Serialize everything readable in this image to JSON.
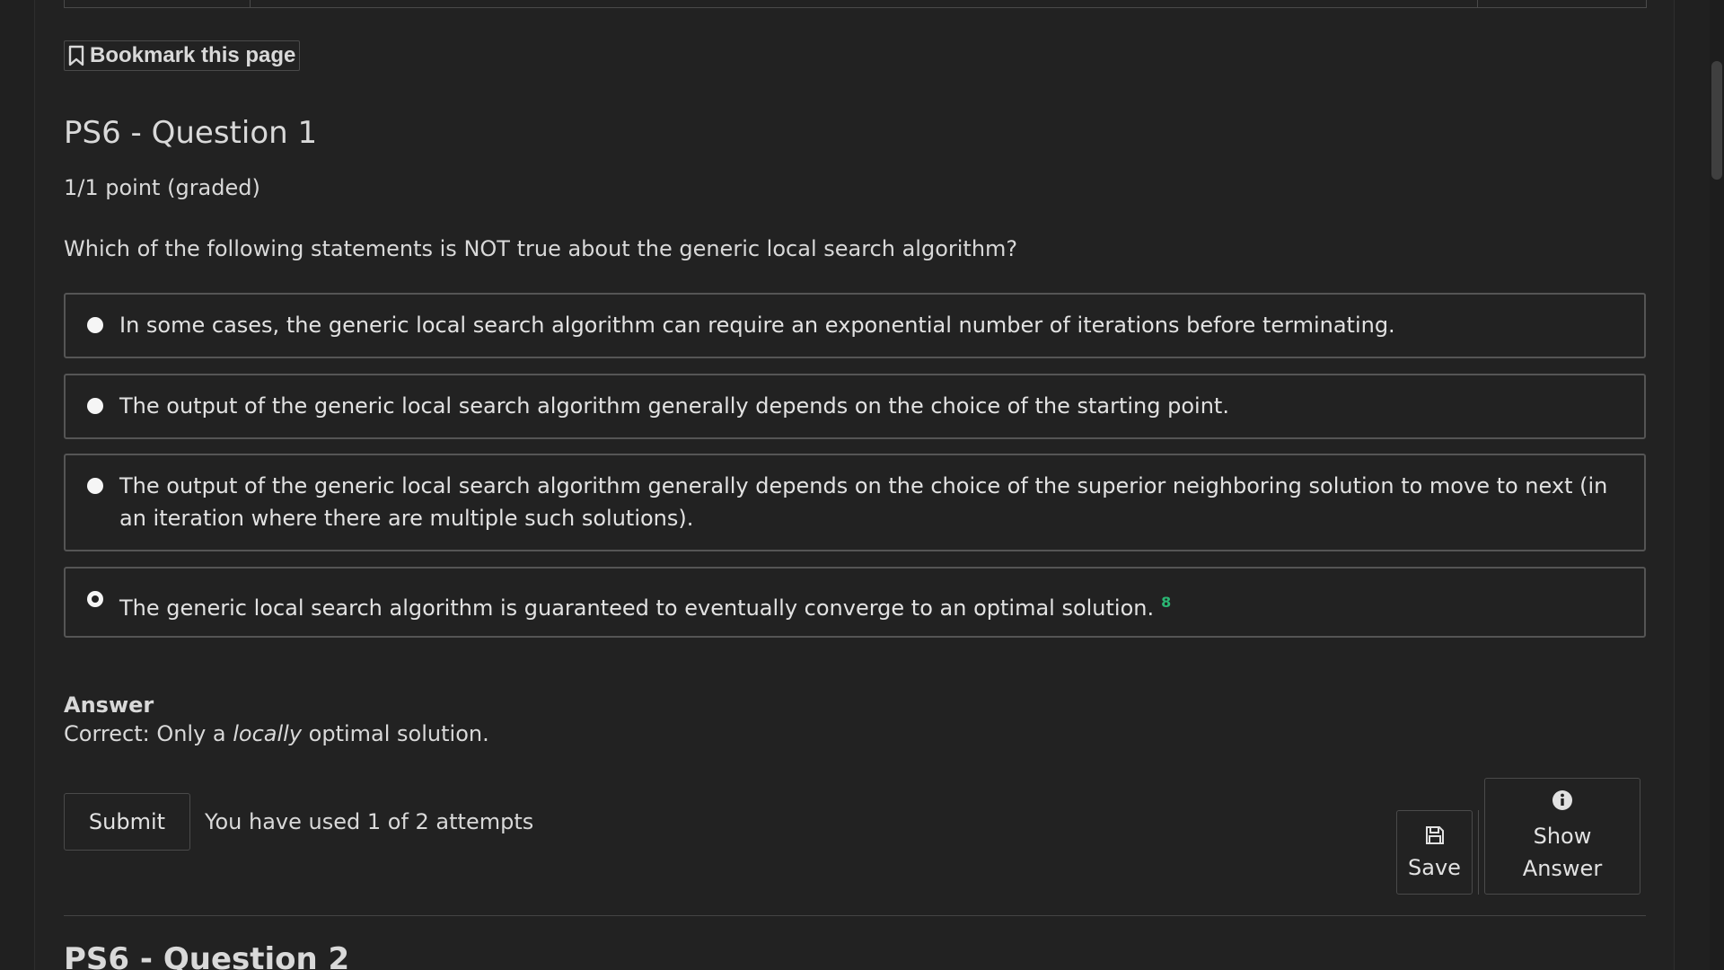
{
  "bookmark": {
    "label": "Bookmark this page",
    "icon": "bookmark-icon"
  },
  "question": {
    "title": "PS6 - Question 1",
    "points": "1/1 point (graded)",
    "prompt": "Which of the following statements is NOT true about the generic local search algorithm?",
    "choices": [
      {
        "text": "In some cases, the generic local search algorithm can require an exponential number of iterations before terminating.",
        "selected": false
      },
      {
        "text": "The output of the generic local search algorithm generally depends on the choice of the starting point.",
        "selected": false
      },
      {
        "text": "The output of the generic local search algorithm generally depends on the choice of the superior neighboring solution to move to next (in an iteration where there are multiple such solutions).",
        "selected": false
      },
      {
        "text": "The generic local search algorithm is guaranteed to eventually converge to an optimal solution.",
        "selected": true,
        "status_mark": "8",
        "status_color": "#2bb673"
      }
    ]
  },
  "answer": {
    "label": "Answer",
    "prefix": "Correct:  Only a ",
    "emphasis": "locally",
    "suffix": " optimal solution."
  },
  "actions": {
    "submit_label": "Submit",
    "attempts_text": "You have used 1 of 2 attempts",
    "save_label": "Save",
    "show_answer_line1": "Show",
    "show_answer_line2": "Answer"
  },
  "next_question": {
    "title": "PS6 - Question 2"
  },
  "colors": {
    "background": "#222222",
    "border": "#555555",
    "text": "#d9d9d9",
    "correct": "#2bb673"
  }
}
